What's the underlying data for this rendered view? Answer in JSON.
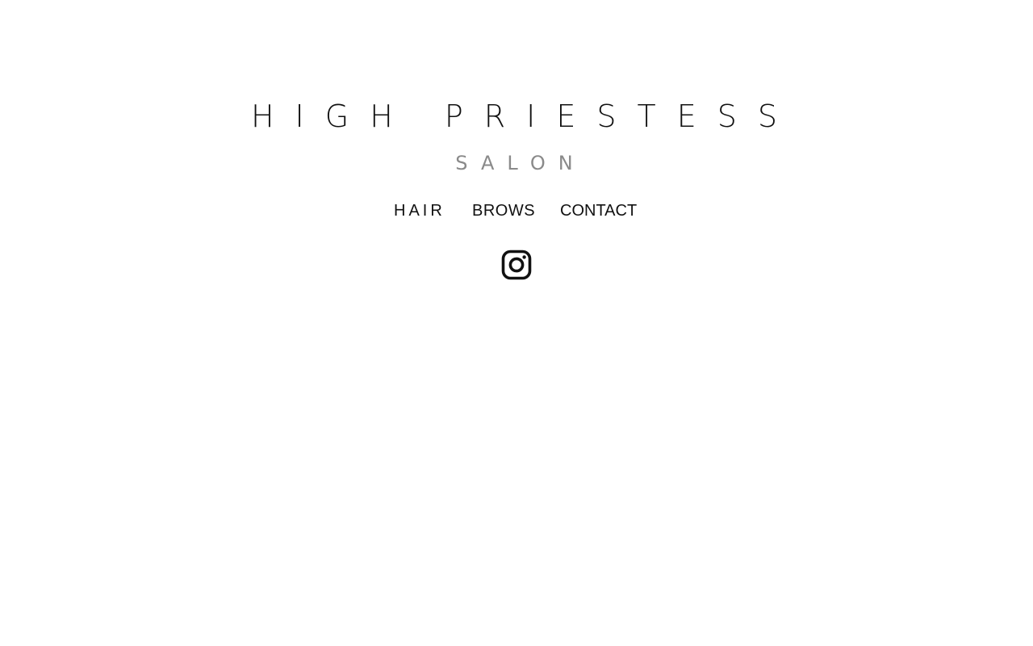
{
  "brand": {
    "title": "HIGH PRIESTESS",
    "subtitle": "SALON"
  },
  "nav": {
    "items": [
      {
        "label": "HAIR"
      },
      {
        "label": "BROWS"
      },
      {
        "label": "CONTACT"
      }
    ]
  },
  "social": {
    "icon": "instagram-icon"
  },
  "colors": {
    "background": "#ffffff",
    "text": "#111111",
    "subtitle": "#8a8a8a"
  }
}
